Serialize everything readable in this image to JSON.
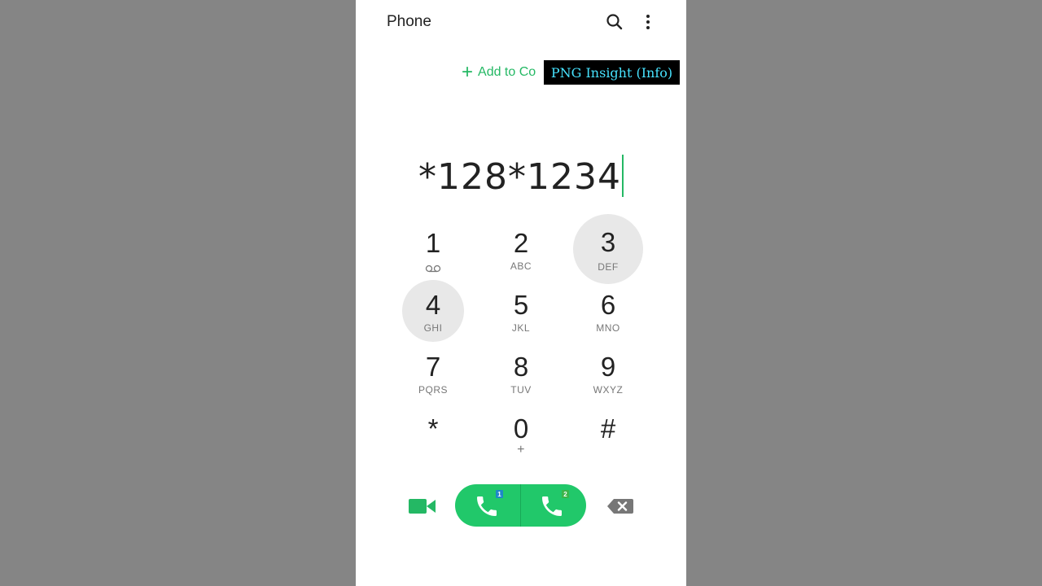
{
  "app": {
    "title": "Phone"
  },
  "header": {
    "search_icon": "search-icon",
    "more_icon": "more-vert-icon"
  },
  "add_contacts": {
    "label": "Add to Co"
  },
  "watermark": {
    "text": "PNG Insight (Info)"
  },
  "dialer": {
    "entered_number": "*128*1234"
  },
  "keypad": {
    "keys": [
      {
        "digit": "1",
        "letters": ""
      },
      {
        "digit": "2",
        "letters": "ABC"
      },
      {
        "digit": "3",
        "letters": "DEF"
      },
      {
        "digit": "4",
        "letters": "GHI"
      },
      {
        "digit": "5",
        "letters": "JKL"
      },
      {
        "digit": "6",
        "letters": "MNO"
      },
      {
        "digit": "7",
        "letters": "PQRS"
      },
      {
        "digit": "8",
        "letters": "TUV"
      },
      {
        "digit": "9",
        "letters": "WXYZ"
      },
      {
        "digit": "*",
        "letters": ""
      },
      {
        "digit": "0",
        "letters": "+"
      },
      {
        "digit": "#",
        "letters": ""
      }
    ]
  },
  "actions": {
    "sim1_badge": "1",
    "sim2_badge": "2"
  },
  "colors": {
    "accent": "#24b864",
    "call_button": "#21c86a",
    "sim1_badge": "#1e88c8",
    "sim2_badge": "#3bb54a",
    "watermark_text": "#47e3ff"
  }
}
